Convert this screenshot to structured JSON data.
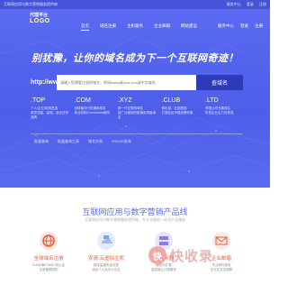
{
  "topbar": {
    "left_text": "互联网应用与数字营销服务提供商",
    "links": [
      "服务中心",
      "登录",
      "注册"
    ]
  },
  "logo": {
    "line1": "代理平台",
    "line2": "LOGO"
  },
  "nav": {
    "items": [
      "首页",
      "域名注册",
      "主机服务",
      "企业邮箱",
      "网站建设"
    ],
    "right": [
      "服务中心",
      "登录",
      "注册"
    ]
  },
  "hero": {
    "slogan": "别犹豫，让你的域名成为下一个互联网奇迹！",
    "www_prefix": "http://www.",
    "search_placeholder": "请输入您想要注册的域名，例如baidu或sina.com或中文域名",
    "search_button": "查域名"
  },
  "domains": [
    {
      "ext": ".TOP",
      "desc": "个人/企业/机构首选\n寓意顶级、高端，适合任何品牌"
    },
    {
      "ext": ".COM",
      "desc": "全球最流行的通用域名\n商业机构Commercial缩写"
    },
    {
      "ext": ".XYZ",
      "desc": "新一代互联网域名\n被广泛使用的新通用顶级域名"
    },
    {
      "ext": ".CLUB",
      "desc": "俱乐部、社团首选\n打造社区专属品牌形象"
    },
    {
      "ext": ".LTD",
      "desc": "有限公司专属域名\n彰显企业实力的首选"
    }
  ],
  "quick_links": [
    "批量查询",
    "批量查询工具",
    "域名交易",
    "WHOIS查询"
  ],
  "section": {
    "title": "互联网应用与数字营销产品线",
    "subtitle": "互联网应用与数字营销服务提供商，专业全面的一站式产品服务"
  },
  "cards": [
    {
      "name": "全球域名注册",
      "desc": "ICANN和CNNIC双认证\n注册管理机构",
      "icon": "globe-icon",
      "color": "#e35b3a"
    },
    {
      "name": "安骑·云虚拟主机",
      "desc": "稳定高速安全可靠\n适合个人及中小企业",
      "icon": "cloud-host-icon",
      "color": "#e35b3a"
    },
    {
      "name": "云服务器",
      "desc": "弹性可扩展\n高性能云计算服务",
      "icon": "server-icon",
      "color": "#e35b3a"
    },
    {
      "name": "企业邮箱",
      "desc": "专业邮件服务\n全方位安全保障",
      "icon": "mail-icon",
      "color": "#e35b3a"
    }
  ],
  "watermark": {
    "text": "快收录",
    "icon_char": "快"
  }
}
